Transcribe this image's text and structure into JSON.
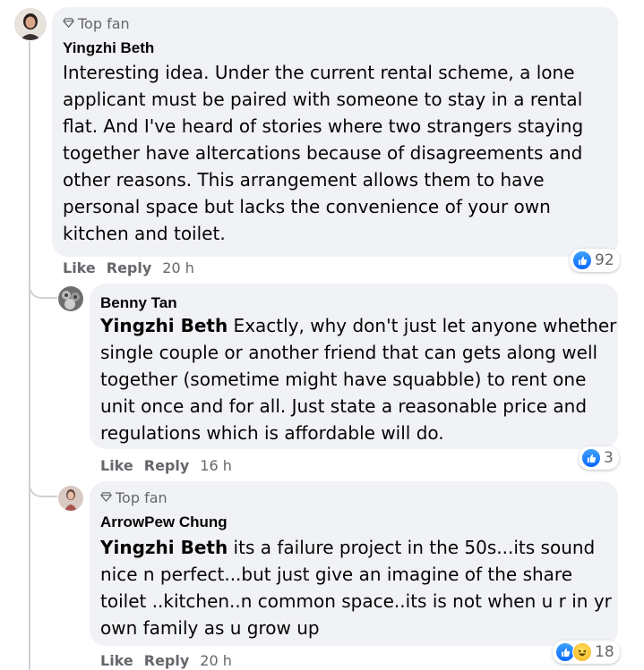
{
  "colors": {
    "bubble": "#f0f2f5",
    "meta_text": "#65676b",
    "like_blue": "#0866ff",
    "thread_line": "#ced0d4"
  },
  "comments": [
    {
      "badge": "Top fan",
      "badge_icon": "diamond-icon",
      "author": "Yingzhi Beth",
      "lines": [
        "Interesting idea. Under the current rental scheme, a lone",
        "applicant must be paired with someone to stay in a rental",
        "flat. And I've heard of stories where two strangers staying",
        "together have altercations because of disagreements and",
        "other reasons. This arrangement allows them to have",
        "personal space but lacks the convenience of your own",
        "kitchen and toilet."
      ],
      "like": "Like",
      "reply": "Reply",
      "time": "20 h",
      "reaction_icons": [
        "like-icon"
      ],
      "reaction_count": "92"
    },
    {
      "author": "Benny Tan",
      "mention": "Yingzhi Beth",
      "first_line_rest": " Exactly, why don't just let anyone whether",
      "lines": [
        "single couple or another friend that can gets along well",
        "together (sometime might have squabble) to rent one",
        "unit once and for all. Just state a reasonable price and",
        "regulations which is affordable will do."
      ],
      "like": "Like",
      "reply": "Reply",
      "time": "16 h",
      "reaction_icons": [
        "like-icon"
      ],
      "reaction_count": "3"
    },
    {
      "badge": "Top fan",
      "badge_icon": "diamond-icon",
      "author": "ArrowPew Chung",
      "mention": "Yingzhi Beth",
      "first_line_rest": " its a failure project in the 50s...its sound",
      "lines": [
        "nice n perfect...but just give an imagine of the share",
        "toilet ..kitchen..n common space..its is not when u r in yr",
        "own family as u grow up"
      ],
      "like": "Like",
      "reply": "Reply",
      "time": "20 h",
      "reaction_icons": [
        "like-icon",
        "haha-icon"
      ],
      "reaction_count": "18"
    }
  ]
}
